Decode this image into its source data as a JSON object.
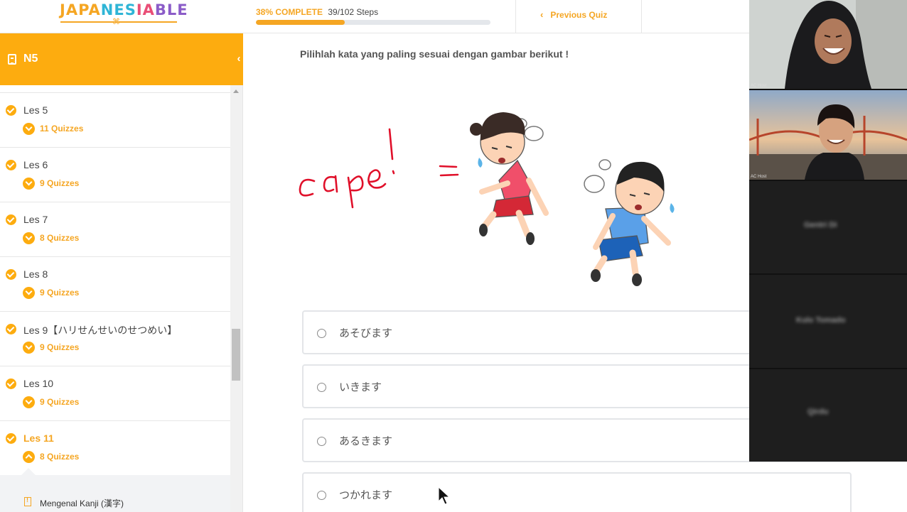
{
  "header": {
    "logo_text": "JAPANESIABLE",
    "progress": {
      "percent_label": "38% COMPLETE",
      "steps_label": "39/102 Steps",
      "percent": 38
    },
    "previous_quiz_label": "Previous Quiz"
  },
  "sidebar": {
    "course_title": "N5",
    "lessons": [
      {
        "name": "Les 5",
        "quizzes": "11 Quizzes"
      },
      {
        "name": "Les 6",
        "quizzes": "9 Quizzes"
      },
      {
        "name": "Les 7",
        "quizzes": "8 Quizzes"
      },
      {
        "name": "Les 8",
        "quizzes": "9 Quizzes"
      },
      {
        "name": "Les 9【ハリせんせいのせつめい】",
        "quizzes": "9 Quizzes"
      },
      {
        "name": "Les 10",
        "quizzes": "9 Quizzes"
      },
      {
        "name": "Les 11",
        "quizzes": "8 Quizzes"
      }
    ],
    "sub_item_label": "Mengenal Kanji (漢字)"
  },
  "quiz": {
    "question": "Pilihlah kata yang paling sesuai dengan gambar berikut !",
    "annotation": "cape! =",
    "answers": [
      "あそびます",
      "いきます",
      "あるきます",
      "つかれます"
    ]
  },
  "video_tiles": {
    "host_tag": "AC Host",
    "participants": [
      "Gentri Di",
      "Kulo Tomado",
      "Qirdu"
    ]
  },
  "colors": {
    "accent": "#fdac0f",
    "ink": "#e0102a"
  }
}
